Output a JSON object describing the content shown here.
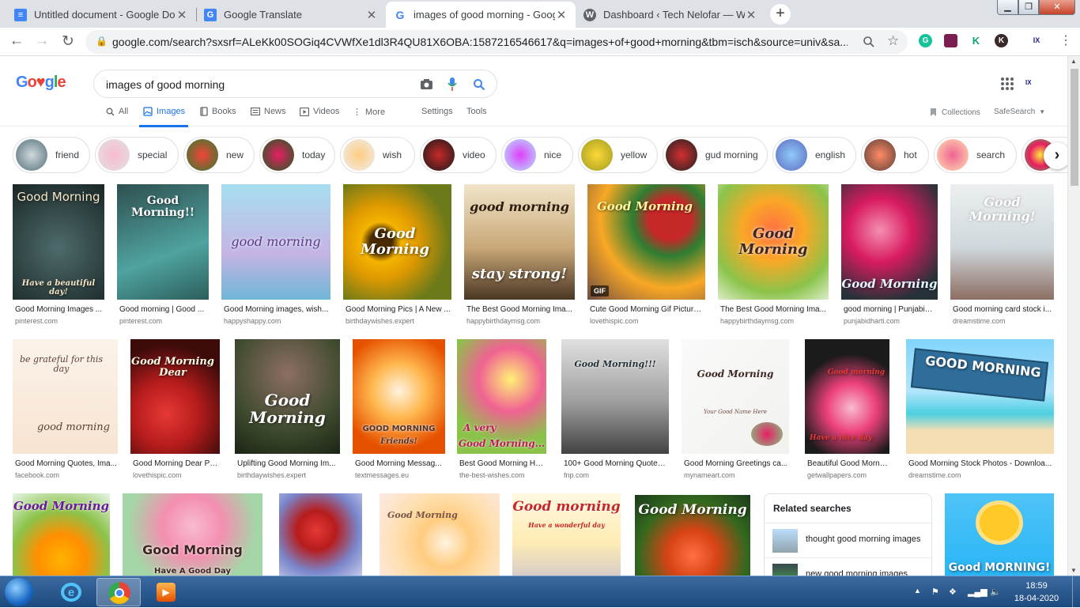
{
  "browser": {
    "tabs": [
      {
        "title": "Untitled document - Google Docs",
        "icon": "docs-icon",
        "color": "#4285f4"
      },
      {
        "title": "Google Translate",
        "icon": "translate-icon",
        "color": "#4285f4"
      },
      {
        "title": "images of good morning - Google Search",
        "icon": "google-icon",
        "color": "#ffffff"
      },
      {
        "title": "Dashboard ‹ Tech Nelofar — WordPress",
        "icon": "wordpress-icon",
        "color": "#5f6368"
      }
    ],
    "url": "google.com/search?sxsrf=ALeKk00SOGiq4CVWfXe1dl3R4QU81X6OBA:1587216546617&q=images+of+good+morning&tbm=isch&source=univ&sa...",
    "ext_g": "G",
    "ext_k1": "K",
    "ext_k2": "K",
    "ext_ix": "IX"
  },
  "google": {
    "logo": "Google",
    "query": "images of good morning",
    "tabs": [
      "All",
      "Images",
      "Books",
      "News",
      "Videos",
      "More",
      "Settings",
      "Tools"
    ],
    "collections": "Collections",
    "safesearch": "SafeSearch"
  },
  "chips": [
    "friend",
    "special",
    "new",
    "today",
    "wish",
    "video",
    "nice",
    "yellow",
    "gud morning",
    "english",
    "hot",
    "search"
  ],
  "row1": [
    {
      "caption": "Good Morning Images ...",
      "source": "pinterest.com",
      "overlay": "Good Morning",
      "sub": "Have a beautiful day!"
    },
    {
      "caption": "Good morning | Good ...",
      "source": "pinterest.com",
      "overlay": "Good Morning!!",
      "sub": ""
    },
    {
      "caption": "Good Morning images, wish...",
      "source": "happyshappy.com",
      "overlay": "good morning",
      "sub": ""
    },
    {
      "caption": "Good Morning Pics | A New ...",
      "source": "birthdaywishes.expert",
      "overlay": "Good Morning",
      "sub": ""
    },
    {
      "caption": "The Best Good Morning Ima...",
      "source": "happybirthdaymsg.com",
      "overlay": "good morning",
      "sub": "stay strong!"
    },
    {
      "caption": "Cute Good Morning Gif Picture...",
      "source": "lovethispic.com",
      "overlay": "Good Morning",
      "sub": "",
      "badge": "GIF"
    },
    {
      "caption": "The Best Good Morning Ima...",
      "source": "happybirthdaymsg.com",
      "overlay": "Good Morning",
      "sub": ""
    },
    {
      "caption": "good morning | PunjabiD...",
      "source": "punjabidharti.com",
      "overlay": "Good Morning",
      "sub": ""
    },
    {
      "caption": "Good morning card stock i...",
      "source": "dreamstime.com",
      "overlay": "Good Morning!",
      "sub": ""
    }
  ],
  "row2": [
    {
      "caption": "Good Morning Quotes, Ima...",
      "source": "facebook.com",
      "overlay": "be grateful for this day",
      "sub": "good morning"
    },
    {
      "caption": "Good Morning Dear Pic...",
      "source": "lovethispic.com",
      "overlay": "Good Morning Dear",
      "sub": ""
    },
    {
      "caption": "Uplifting Good Morning Im...",
      "source": "birthdaywishes.expert",
      "overlay": "Good Morning",
      "sub": ""
    },
    {
      "caption": "Good Morning Messag...",
      "source": "textmessages.eu",
      "overlay": "GOOD MORNING",
      "sub": "Friends!"
    },
    {
      "caption": "Best Good Morning HD...",
      "source": "the-best-wishes.com",
      "overlay": "A very",
      "sub": "Good Morning..."
    },
    {
      "caption": "100+ Good Morning Quotes...",
      "source": "fnp.com",
      "overlay": "Good Morning!!!",
      "sub": ""
    },
    {
      "caption": "Good Morning Greetings ca...",
      "source": "mynameart.com",
      "overlay": "Good Morning",
      "sub": "Your Good Name Here"
    },
    {
      "caption": "Beautiful Good Mornin...",
      "source": "getwallpapers.com",
      "overlay": "Good morning",
      "sub": "Have a nice day"
    },
    {
      "caption": "Good Morning Stock Photos - Downloa...",
      "source": "dreamstime.com",
      "overlay": "GOOD MORNING",
      "sub": ""
    }
  ],
  "row3": [
    {
      "overlay": "Good Morning",
      "sub": ""
    },
    {
      "overlay": "Good Morning",
      "sub": "Have A Good Day"
    },
    {
      "overlay": "",
      "sub": ""
    },
    {
      "overlay": "Good Morning",
      "sub": ""
    },
    {
      "overlay": "Good morning",
      "sub": "Have a wonderful day"
    },
    {
      "overlay": "Good Morning",
      "sub": ""
    },
    {
      "overlay": "Good MORNING!",
      "sub": ""
    }
  ],
  "related": {
    "heading": "Related searches",
    "items": [
      "thought good morning images",
      "new good morning images"
    ]
  },
  "taskbar": {
    "time": "18:59",
    "date": "18-04-2020"
  }
}
